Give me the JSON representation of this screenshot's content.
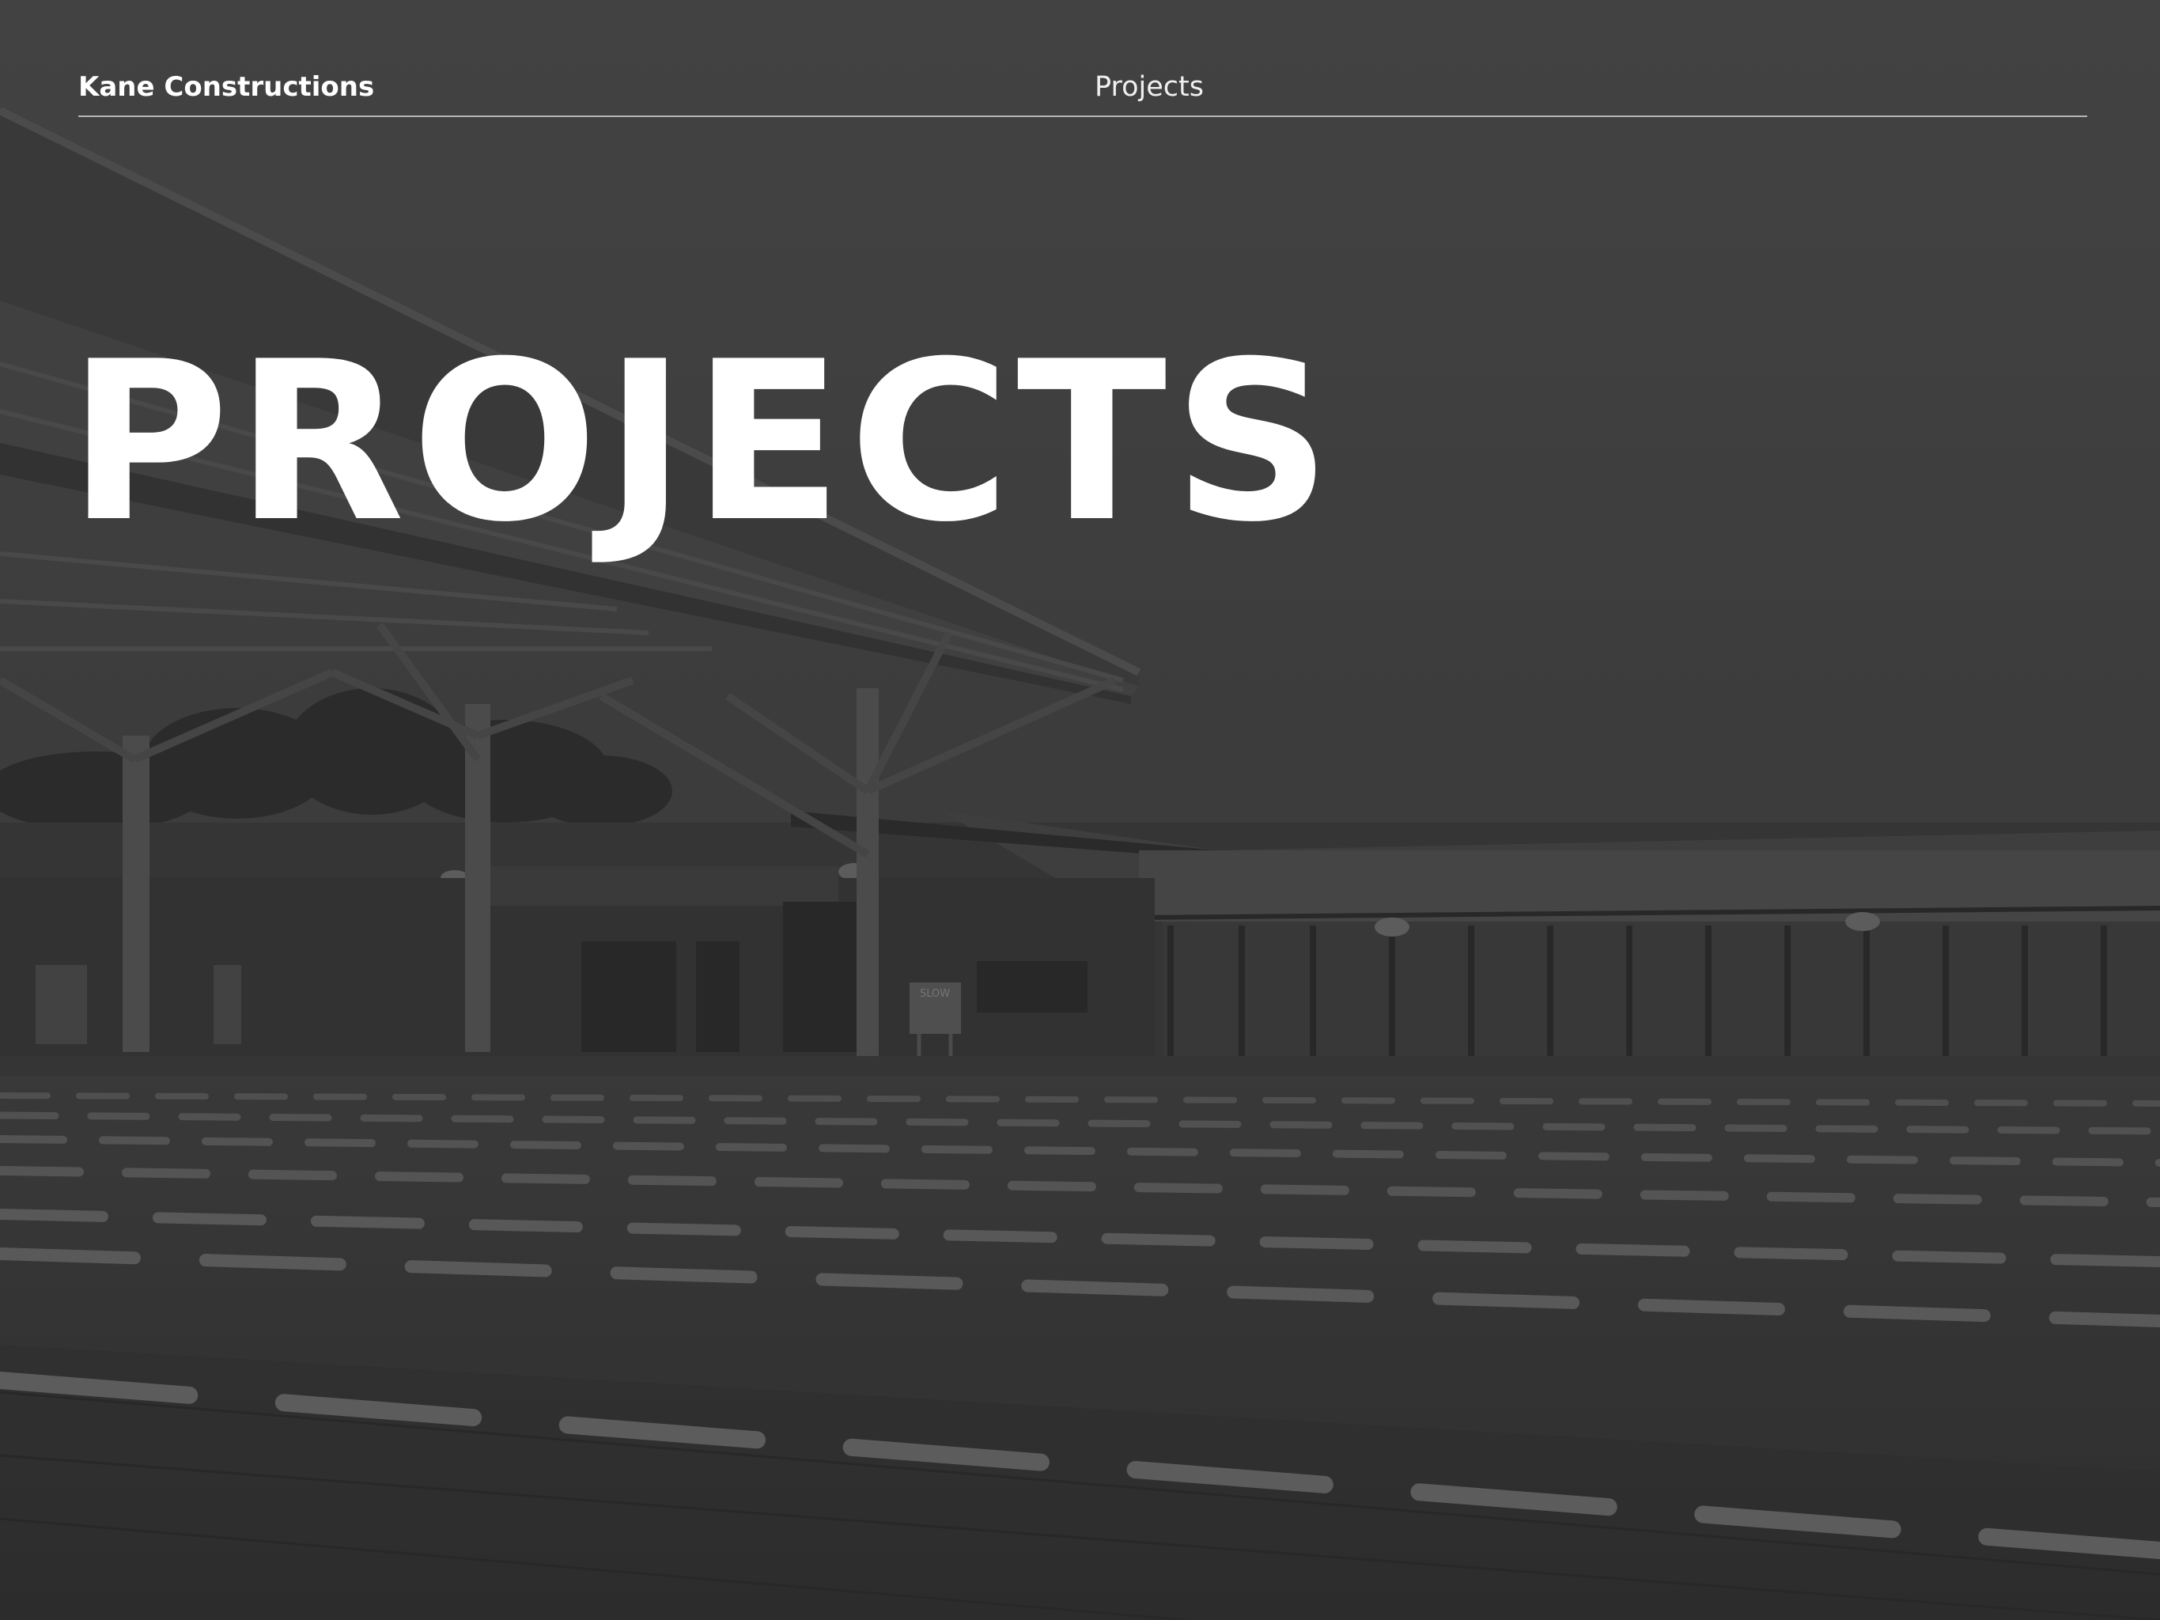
{
  "header": {
    "brand": "Kane Constructions",
    "section": "Projects"
  },
  "hero": {
    "title": "PROJECTS"
  },
  "background_photo": {
    "sign_text": "SLOW"
  }
}
